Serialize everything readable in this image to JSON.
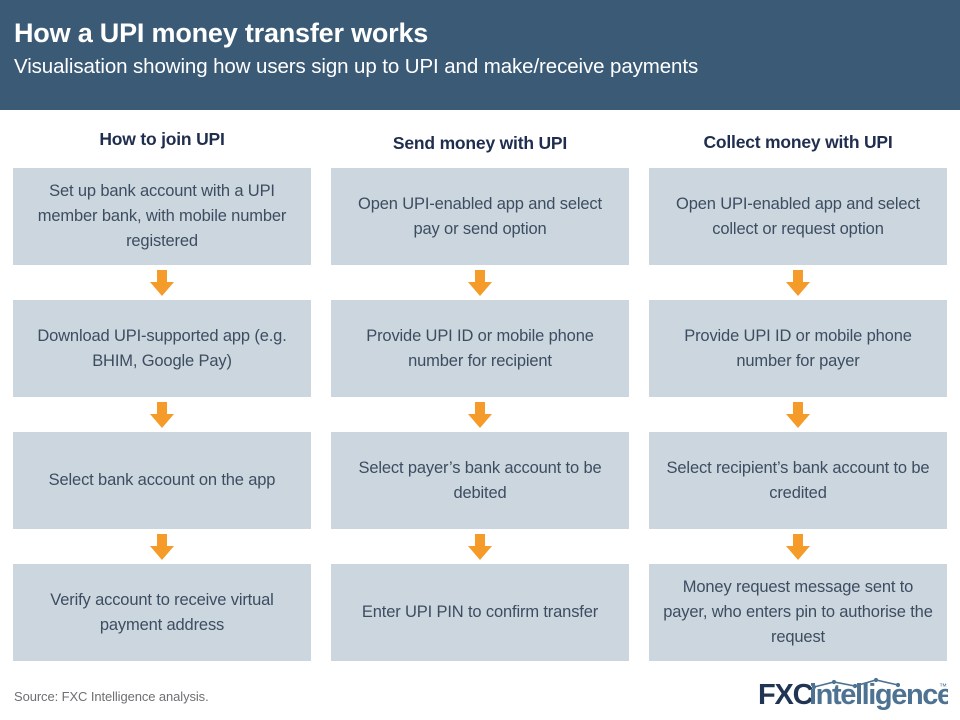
{
  "header": {
    "title": "How a UPI money transfer works",
    "subtitle": "Visualisation showing how users sign up to UPI and make/receive payments",
    "background_color": "#3a5a76",
    "text_color": "#ffffff"
  },
  "theme": {
    "box_fill": "#ccd6de",
    "box_text": "#3d4d61",
    "column_header_text": "#1f2d4e",
    "arrow_color": "#f59b29",
    "page_background": "#ffffff"
  },
  "chart_data": {
    "type": "diagram",
    "title": "How a UPI money transfer works",
    "subtitle": "Visualisation showing how users sign up to UPI and make/receive payments",
    "layout": "three parallel vertical flowcharts, four steps each, connected by downward arrows",
    "columns": [
      {
        "header": "How to join UPI",
        "steps": [
          "Set up bank account with a UPI member bank, with mobile number registered",
          "Download UPI-supported app (e.g. BHIM, Google Pay)",
          "Select bank account on the app",
          "Verify account to receive virtual payment address"
        ]
      },
      {
        "header": "Send money with UPI",
        "steps": [
          "Open UPI-enabled app and select pay or send option",
          "Provide UPI ID or mobile phone number for recipient",
          "Select payer’s bank account to be debited",
          "Enter UPI PIN to confirm transfer"
        ]
      },
      {
        "header": "Collect money with UPI",
        "steps": [
          "Open UPI-enabled app and select collect or request option",
          "Provide UPI ID or mobile phone number for payer",
          "Select recipient’s bank account to be credited",
          "Money request message sent to payer, who enters pin to authorise the request"
        ]
      }
    ]
  },
  "footer": {
    "source": "Source: FXC Intelligence analysis.",
    "logo": {
      "part_bold": "FXC",
      "part_light": "intelligence",
      "trademark": "™",
      "bold_color": "#1f3553",
      "light_color": "#4e7292"
    }
  }
}
